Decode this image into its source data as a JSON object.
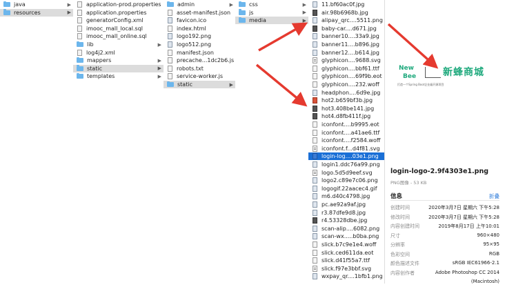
{
  "col1": [
    {
      "label": "java",
      "type": "folder",
      "chevron": true,
      "sel": ""
    },
    {
      "label": "resources",
      "type": "folder",
      "chevron": true,
      "sel": "gray"
    }
  ],
  "col2": [
    {
      "label": "application-prod.properties",
      "type": "file"
    },
    {
      "label": "application.properties",
      "type": "file"
    },
    {
      "label": "generatorConfig.xml",
      "type": "file"
    },
    {
      "label": "imooc_mall_local.sql",
      "type": "file"
    },
    {
      "label": "imooc_mall_online.sql",
      "type": "file"
    },
    {
      "label": "lib",
      "type": "folder",
      "chevron": true
    },
    {
      "label": "log4j2.xml",
      "type": "file"
    },
    {
      "label": "mappers",
      "type": "folder",
      "chevron": true
    },
    {
      "label": "static",
      "type": "folder",
      "chevron": true,
      "sel": "gray"
    },
    {
      "label": "templates",
      "type": "folder",
      "chevron": true
    }
  ],
  "col3": [
    {
      "label": "admin",
      "type": "folder",
      "chevron": true
    },
    {
      "label": "asset-manifest.json",
      "type": "file"
    },
    {
      "label": "favicon.ico",
      "type": "img"
    },
    {
      "label": "index.html",
      "type": "file"
    },
    {
      "label": "logo192.png",
      "type": "img"
    },
    {
      "label": "logo512.png",
      "type": "img"
    },
    {
      "label": "manifest.json",
      "type": "file"
    },
    {
      "label": "precache...1dc2b6.js",
      "type": "file"
    },
    {
      "label": "robots.txt",
      "type": "file"
    },
    {
      "label": "service-worker.js",
      "type": "file"
    },
    {
      "label": "static",
      "type": "folder",
      "chevron": true,
      "sel": "gray"
    }
  ],
  "col4": [
    {
      "label": "css",
      "type": "folder",
      "chevron": true
    },
    {
      "label": "js",
      "type": "folder",
      "chevron": true
    },
    {
      "label": "media",
      "type": "folder",
      "chevron": true,
      "sel": "gray"
    }
  ],
  "col5": [
    {
      "label": "11.bf60ac0f.jpg",
      "type": "img"
    },
    {
      "label": "air.98b6968b.jpg",
      "type": "dark"
    },
    {
      "label": "alipay_qrc....5511.png",
      "type": "img"
    },
    {
      "label": "baby-car....d671.jpg",
      "type": "dark"
    },
    {
      "label": "banner10....33a9.jpg",
      "type": "img"
    },
    {
      "label": "banner11....b896.jpg",
      "type": "img"
    },
    {
      "label": "banner12....b614.jpg",
      "type": "img"
    },
    {
      "label": "glyphicon....9688.svg",
      "type": "code"
    },
    {
      "label": "glyphicon....bbf61.ttf",
      "type": "file"
    },
    {
      "label": "glyphicon....69f9b.eot",
      "type": "file"
    },
    {
      "label": "glyphicon....232.woff",
      "type": "file"
    },
    {
      "label": "headphon....6d9e.jpg",
      "type": "img"
    },
    {
      "label": "hot2.b659bf3b.jpg",
      "type": "red"
    },
    {
      "label": "hot3.408be141.jpg",
      "type": "dark"
    },
    {
      "label": "hot4.d8fb411f.jpg",
      "type": "dark"
    },
    {
      "label": "iconfont....b9995.eot",
      "type": "file"
    },
    {
      "label": "iconfont....a41ae6.ttf",
      "type": "file"
    },
    {
      "label": "iconfont....f2584.woff",
      "type": "file"
    },
    {
      "label": "iconfont.f...d4f81.svg",
      "type": "code"
    },
    {
      "label": "login-log....03e1.png",
      "type": "blue",
      "sel": "blue"
    },
    {
      "label": "login1.ddc76a99.png",
      "type": "img"
    },
    {
      "label": "logo.5d5d9eef.svg",
      "type": "code"
    },
    {
      "label": "logo2.c89e7c06.png",
      "type": "img"
    },
    {
      "label": "logogif.22aacec4.gif",
      "type": "img"
    },
    {
      "label": "m6.d40c4798.jpg",
      "type": "img"
    },
    {
      "label": "pc.ae92a9af.jpg",
      "type": "img"
    },
    {
      "label": "r3.87dfe9d8.jpg",
      "type": "img"
    },
    {
      "label": "r4.53328dbe.jpg",
      "type": "dark"
    },
    {
      "label": "scan-alip....6082.png",
      "type": "img"
    },
    {
      "label": "scan-wx.....b0ba.png",
      "type": "img"
    },
    {
      "label": "slick.b7c9e1e4.woff",
      "type": "file"
    },
    {
      "label": "slick.ced611da.eot",
      "type": "file"
    },
    {
      "label": "slick.d41f55a7.ttf",
      "type": "file"
    },
    {
      "label": "slick.f97e3bbf.svg",
      "type": "code"
    },
    {
      "label": "wxpay_qr....1bfb1.png",
      "type": "img"
    }
  ],
  "preview": {
    "logo_new": "New",
    "logo_bee": "Bee",
    "logo_cn": "新蜂商城",
    "logo_sub": "打造一个Spring Boot企业级开源项目",
    "filename": "login-logo-2.9f4303e1.png",
    "subtitle": "PNG图像 - 53 KB",
    "info_label": "信息",
    "info_more": "折叠",
    "info": [
      {
        "k": "创建时间",
        "v": "2020年3月7日 星期六 下午5:28"
      },
      {
        "k": "修改时间",
        "v": "2020年3月7日 星期六 下午5:28"
      },
      {
        "k": "内容创建时间",
        "v": "2019年8月17日 上午10:01"
      },
      {
        "k": "尺寸",
        "v": "960×480"
      },
      {
        "k": "分辨率",
        "v": "95×95"
      },
      {
        "k": "色彩空间",
        "v": "RGB"
      },
      {
        "k": "颜色描述文件",
        "v": "sRGB IEC61966-2.1"
      },
      {
        "k": "内容创作者",
        "v": "Adobe Photoshop CC 2014"
      },
      {
        "k": "",
        "v": "(Macintosh)"
      }
    ]
  },
  "colors": {
    "accent": "#1a6fd6",
    "folder": "#6cb6ec",
    "arrow": "#e53a2f",
    "brand": "#1fa97d"
  }
}
